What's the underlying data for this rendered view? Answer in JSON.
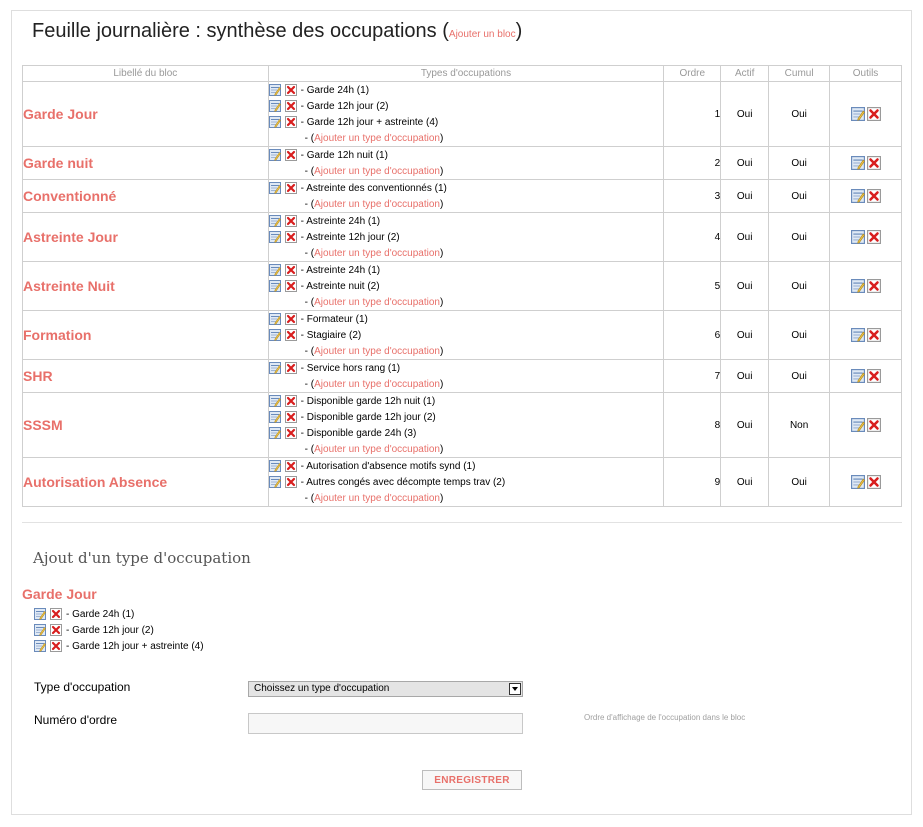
{
  "page": {
    "title": "Feuille journalière : synthèse des occupations (",
    "title_close": ")",
    "add_block_link": "Ajouter un bloc"
  },
  "table": {
    "headers": [
      "Libellé du bloc",
      "Types d'occupations",
      "Ordre",
      "Actif",
      "Cumul",
      "Outils"
    ],
    "add_type_prefix": "- ( ",
    "add_type_link": "Ajouter un type d'occupation",
    "add_type_suffix": " )",
    "rows": [
      {
        "label": "Garde Jour",
        "types": [
          "- Garde 24h (1)",
          "- Garde 12h jour (2)",
          "- Garde 12h jour + astreinte (4)"
        ],
        "order": "1",
        "actif": "Oui",
        "cumul": "Oui"
      },
      {
        "label": "Garde nuit",
        "types": [
          "- Garde 12h nuit (1)"
        ],
        "order": "2",
        "actif": "Oui",
        "cumul": "Oui"
      },
      {
        "label": "Conventionné",
        "types": [
          "- Astreinte des conventionnés (1)"
        ],
        "order": "3",
        "actif": "Oui",
        "cumul": "Oui"
      },
      {
        "label": "Astreinte Jour",
        "types": [
          "- Astreinte 24h (1)",
          "- Astreinte 12h jour (2)"
        ],
        "order": "4",
        "actif": "Oui",
        "cumul": "Oui"
      },
      {
        "label": "Astreinte Nuit",
        "types": [
          "- Astreinte 24h (1)",
          "- Astreinte nuit (2)"
        ],
        "order": "5",
        "actif": "Oui",
        "cumul": "Oui"
      },
      {
        "label": "Formation",
        "types": [
          "- Formateur (1)",
          "- Stagiaire (2)"
        ],
        "order": "6",
        "actif": "Oui",
        "cumul": "Oui"
      },
      {
        "label": "SHR",
        "types": [
          "- Service hors rang (1)"
        ],
        "order": "7",
        "actif": "Oui",
        "cumul": "Oui"
      },
      {
        "label": "SSSM",
        "types": [
          "- Disponible garde 12h nuit (1)",
          "- Disponible garde 12h jour (2)",
          "- Disponible garde 24h (3)"
        ],
        "order": "8",
        "actif": "Oui",
        "cumul": "Non"
      },
      {
        "label": "Autorisation Absence",
        "types": [
          "- Autorisation d'absence motifs synd (1)",
          "- Autres congés avec décompte temps trav (2)"
        ],
        "order": "9",
        "actif": "Oui",
        "cumul": "Oui"
      }
    ]
  },
  "add_section": {
    "title": "Ajout d'un type d'occupation",
    "block_name": "Garde Jour",
    "types": [
      "- Garde 24h (1)",
      "- Garde 12h jour (2)",
      "- Garde 12h jour + astreinte (4)"
    ],
    "type_label": "Type d'occupation",
    "type_select_value": "Choissez un type d'occupation",
    "order_label": "Numéro d'ordre",
    "order_value": "",
    "order_hint": "Ordre d'affichage de l'occupation dans le bloc",
    "save_label": "ENREGISTRER"
  },
  "colors": {
    "accent": "#e8706a",
    "border": "#cfcfcf",
    "header_text": "#999999"
  },
  "icons": {
    "edit": "edit-icon",
    "delete": "delete-icon"
  }
}
